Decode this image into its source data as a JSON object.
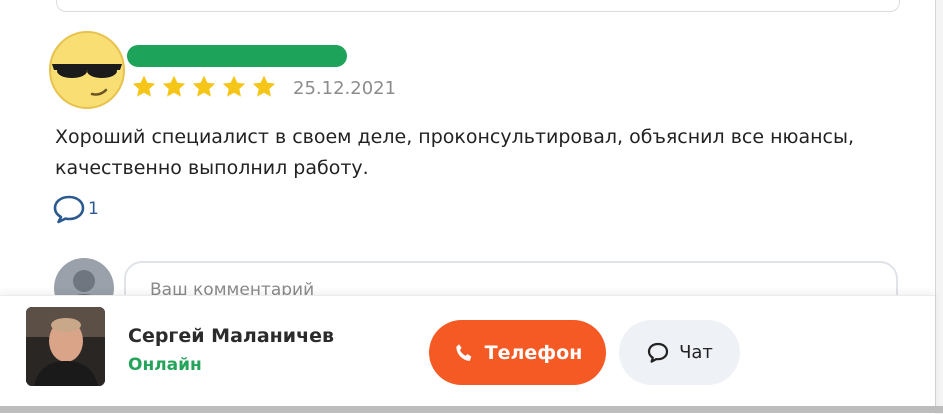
{
  "review": {
    "date": "25.12.2021",
    "rating": 5,
    "rating_max": 5,
    "text": "Хороший специалист в своем деле, проконсультировал, объяснил все нюансы, качественно выполнил работу.",
    "comment_count": "1"
  },
  "comment_form": {
    "placeholder": "Ваш комментарий"
  },
  "specialist": {
    "name": "Сергей Маланичев",
    "status": "Онлайн"
  },
  "actions": {
    "phone_label": "Телефон",
    "chat_label": "Чат"
  },
  "colors": {
    "accent_orange": "#f55a24",
    "online_green": "#24a35a",
    "star_yellow": "#f5c518"
  }
}
